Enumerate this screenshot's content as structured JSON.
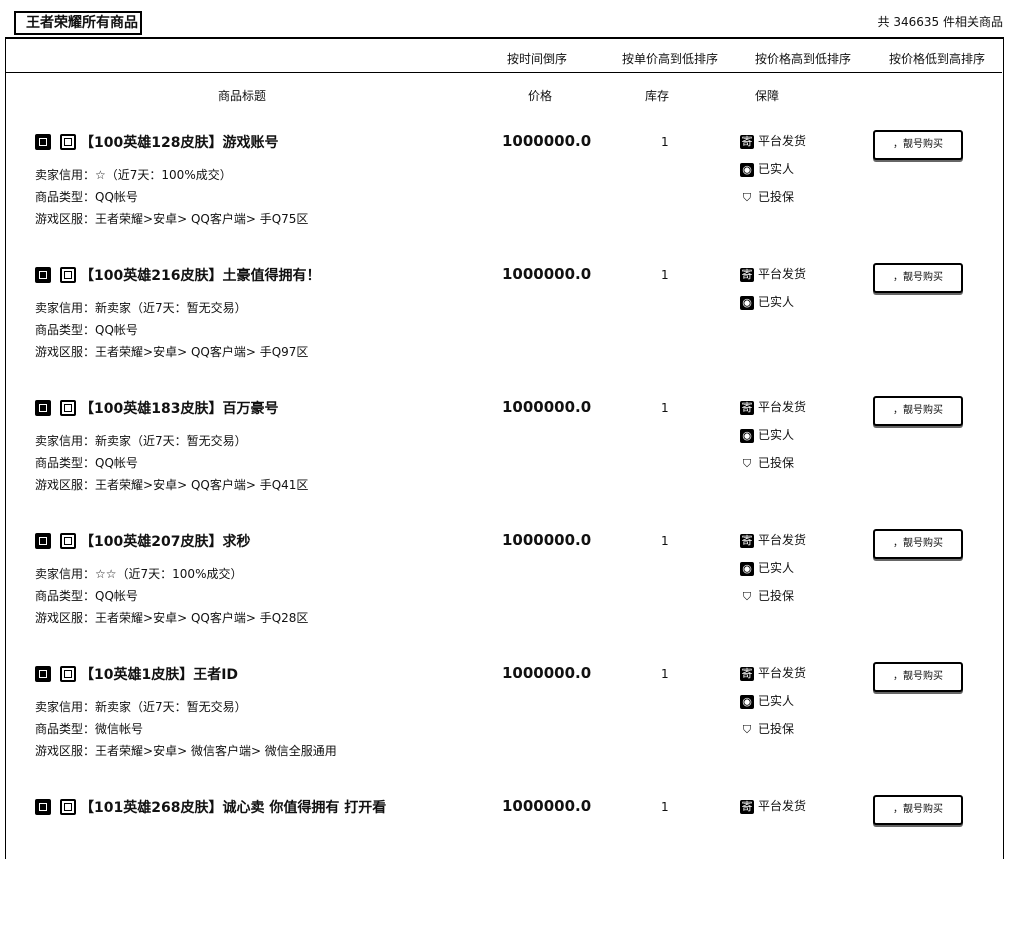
{
  "header": {
    "title": "王者荣耀所有商品",
    "total": "共 346635 件相关商品"
  },
  "sort": {
    "by_time": "按时间倒序",
    "by_unit_price": "按单价高到低排序",
    "price_high_low": "按价格高到低排序",
    "price_low_high": "按价格低到高排序"
  },
  "columns": {
    "title": "商品标题",
    "price": "价格",
    "stock": "库存",
    "guarantee": "保障"
  },
  "labels": {
    "seller": "卖家信用：",
    "type": "商品类型：",
    "server": "游戏区服：",
    "platform": "平台发货",
    "verified": "已实人",
    "insured": "已投保",
    "buy_button": "，靓号购买"
  },
  "items": [
    {
      "title": "【100英雄128皮肤】游戏账号",
      "price": "1000000.0",
      "stock": "1",
      "stars": "☆",
      "credit": "（近7天：100%成交）",
      "type": "QQ帐号",
      "server": "王者荣耀>安卓> QQ客户端> 手Q75区",
      "insured": true
    },
    {
      "title": "【100英雄216皮肤】土豪值得拥有！",
      "price": "1000000.0",
      "stock": "1",
      "stars": "",
      "credit": "新卖家（近7天：暂无交易）",
      "type": "QQ帐号",
      "server": "王者荣耀>安卓> QQ客户端> 手Q97区",
      "insured": false
    },
    {
      "title": "【100英雄183皮肤】百万豪号",
      "price": "1000000.0",
      "stock": "1",
      "stars": "",
      "credit": "新卖家（近7天：暂无交易）",
      "type": "QQ帐号",
      "server": "王者荣耀>安卓> QQ客户端> 手Q41区",
      "insured": true
    },
    {
      "title": "【100英雄207皮肤】求秒",
      "price": "1000000.0",
      "stock": "1",
      "stars": "☆☆",
      "credit": "（近7天：100%成交）",
      "type": "QQ帐号",
      "server": "王者荣耀>安卓> QQ客户端> 手Q28区",
      "insured": true
    },
    {
      "title": "【10英雄1皮肤】王者ID",
      "price": "1000000.0",
      "stock": "1",
      "stars": "",
      "credit": "新卖家（近7天：暂无交易）",
      "type": "微信帐号",
      "server": "王者荣耀>安卓> 微信客户端> 微信全服通用",
      "insured": true
    },
    {
      "title": "【101英雄268皮肤】诚心卖 你值得拥有 打开看",
      "price": "1000000.0",
      "stock": "1",
      "stars": "",
      "credit": "",
      "type": "",
      "server": "",
      "insured": false
    }
  ]
}
